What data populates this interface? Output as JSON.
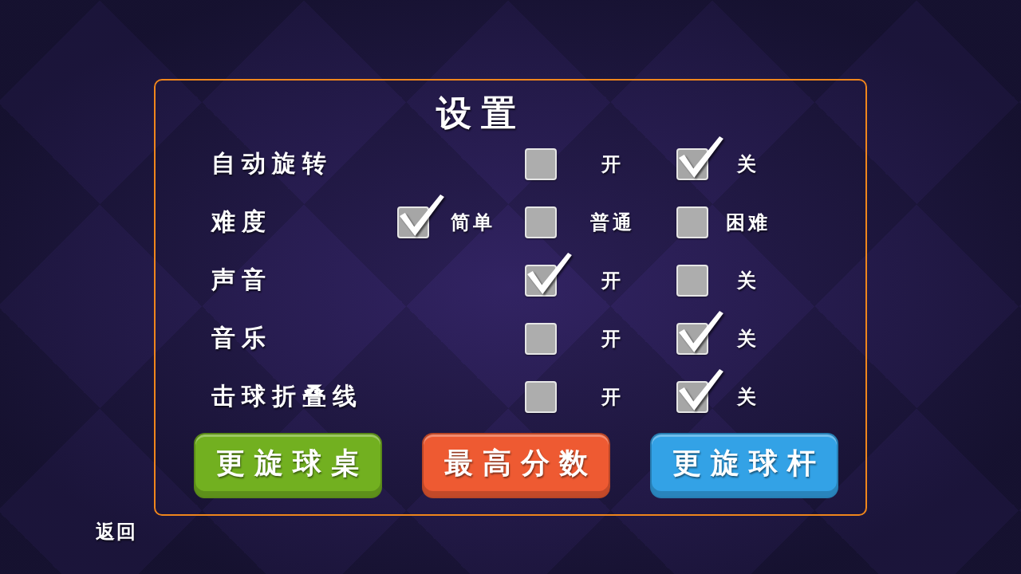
{
  "title": "设置",
  "settings": [
    {
      "label": "自动旋转",
      "options": [
        {
          "label": "开",
          "checked": false
        },
        {
          "label": "关",
          "checked": true
        }
      ]
    },
    {
      "label": "难度",
      "options": [
        {
          "label": "简单",
          "checked": true
        },
        {
          "label": "普通",
          "checked": false
        },
        {
          "label": "困难",
          "checked": false
        }
      ]
    },
    {
      "label": "声音",
      "options": [
        {
          "label": "开",
          "checked": true
        },
        {
          "label": "关",
          "checked": false
        }
      ]
    },
    {
      "label": "音乐",
      "options": [
        {
          "label": "开",
          "checked": false
        },
        {
          "label": "关",
          "checked": true
        }
      ]
    },
    {
      "label": "击球折叠线",
      "options": [
        {
          "label": "开",
          "checked": false
        },
        {
          "label": "关",
          "checked": true
        }
      ]
    }
  ],
  "buttons": [
    {
      "label": "更旋球桌",
      "color": "#72b020"
    },
    {
      "label": "最高分数",
      "color": "#ee5a32"
    },
    {
      "label": "更旋球杆",
      "color": "#33a2e6"
    }
  ],
  "back": "返回"
}
